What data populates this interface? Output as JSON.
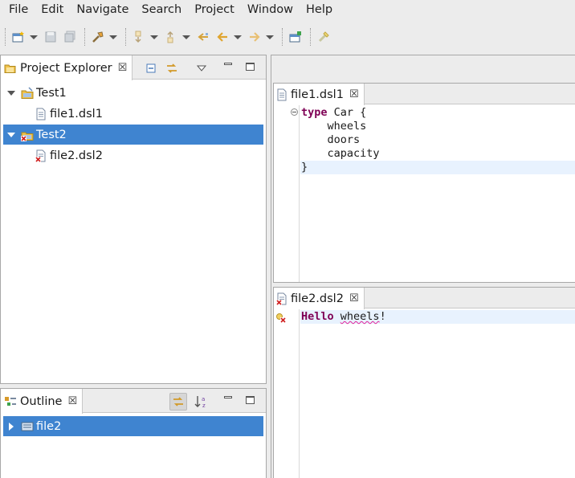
{
  "menu": {
    "items": [
      "File",
      "Edit",
      "Navigate",
      "Search",
      "Project",
      "Window",
      "Help"
    ]
  },
  "toolbar": {
    "buttons": [
      "new-icon",
      "save-icon",
      "save-all-icon",
      "build-icon",
      "next-annotation-icon",
      "previous-annotation-icon",
      "last-edit-icon",
      "back-icon",
      "forward-icon",
      "open-perspective-icon",
      "pin-icon"
    ]
  },
  "project_explorer": {
    "title": "Project Explorer",
    "tree": [
      {
        "label": "Test1",
        "level": 0,
        "expanded": true,
        "selected": false,
        "icon": "project-icon"
      },
      {
        "label": "file1.dsl1",
        "level": 1,
        "selected": false,
        "icon": "file-icon"
      },
      {
        "label": "Test2",
        "level": 0,
        "expanded": true,
        "selected": true,
        "icon": "project-error-icon"
      },
      {
        "label": "file2.dsl2",
        "level": 1,
        "selected": false,
        "icon": "file-error-icon"
      }
    ]
  },
  "outline": {
    "title": "Outline",
    "tree": [
      {
        "label": "file2",
        "expanded": false,
        "selected": true,
        "icon": "model-icon"
      }
    ]
  },
  "editors": [
    {
      "tab": "file1.dsl1",
      "has_error": false,
      "lines": [
        {
          "kw": "type",
          "text": " Car {"
        },
        {
          "kw": "",
          "text": "    wheels"
        },
        {
          "kw": "",
          "text": "    doors"
        },
        {
          "kw": "",
          "text": "    capacity"
        },
        {
          "kw": "",
          "text": "}"
        }
      ]
    },
    {
      "tab": "file2.dsl2",
      "has_error": true,
      "lines": [
        {
          "kw": "Hello",
          "text": " ",
          "err": "wheels",
          "tail": "!"
        }
      ]
    }
  ],
  "colors": {
    "selection": "#3f84d0",
    "keyword": "#7f0055",
    "current_line": "#e8f2fe",
    "error_squiggle": "#e0229a"
  }
}
